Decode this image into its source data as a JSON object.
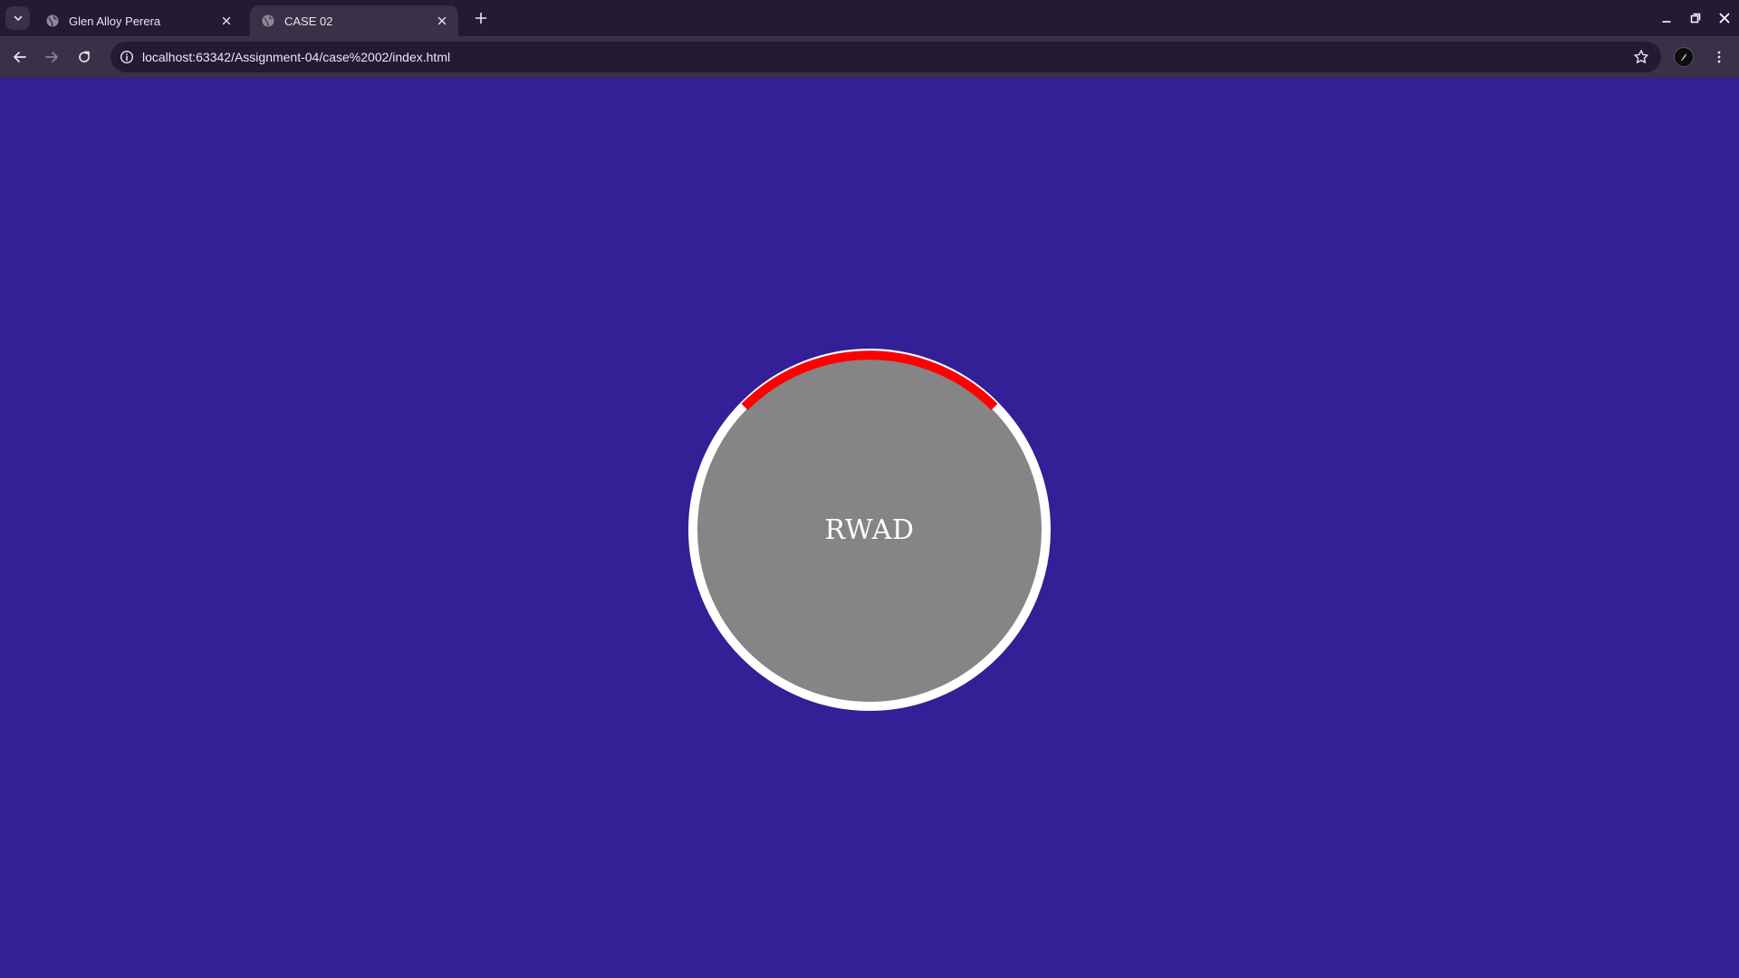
{
  "tabs": [
    {
      "title": "Glen Alloy Perera",
      "active": false
    },
    {
      "title": "CASE 02",
      "active": true
    }
  ],
  "address_bar": {
    "url": "localhost:63342/Assignment-04/case%2002/index.html"
  },
  "page": {
    "loader_text": "RWAD"
  },
  "colors": {
    "page_background": "#331f96",
    "circle_fill": "#858585",
    "circle_border": "#ffffff",
    "arc_accent": "#ff0000"
  },
  "icons": {
    "tab_search": "chevron-down-icon",
    "favicon": "globe-icon",
    "tab_close": "close-icon",
    "new_tab": "plus-icon",
    "back": "arrow-left-icon",
    "forward": "arrow-right-icon",
    "reload": "reload-icon",
    "site_info": "info-icon",
    "bookmark": "star-icon",
    "profile": "profile-icon",
    "menu": "kebab-menu-icon",
    "minimize": "minimize-icon",
    "restore": "restore-icon",
    "close_window": "close-window-icon"
  }
}
